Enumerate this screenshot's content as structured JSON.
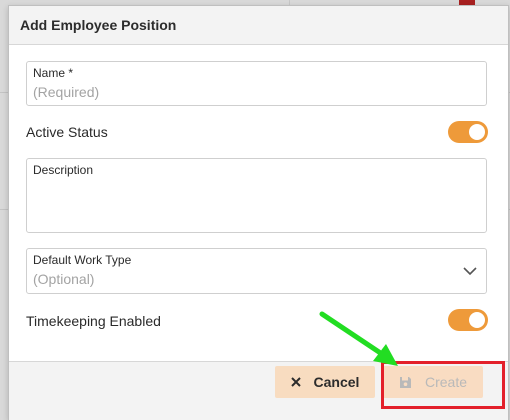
{
  "dialog": {
    "title": "Add Employee Position"
  },
  "form": {
    "name": {
      "label": "Name *",
      "placeholder": "(Required)"
    },
    "active_status": {
      "label": "Active Status",
      "enabled": true
    },
    "description": {
      "label": "Description",
      "value": ""
    },
    "default_work_type": {
      "label": "Default Work Type",
      "placeholder": "(Optional)"
    },
    "timekeeping": {
      "label": "Timekeeping Enabled",
      "enabled": true
    }
  },
  "footer": {
    "cancel_label": "Cancel",
    "create_label": "Create"
  },
  "colors": {
    "accent": "#ee9a3a",
    "button_bg": "#f8dcc0",
    "highlight": "#e3202a",
    "arrow": "#22dd22"
  },
  "icons": {
    "cancel": "close-icon",
    "create": "save-icon",
    "dropdown": "chevron-down-icon"
  }
}
